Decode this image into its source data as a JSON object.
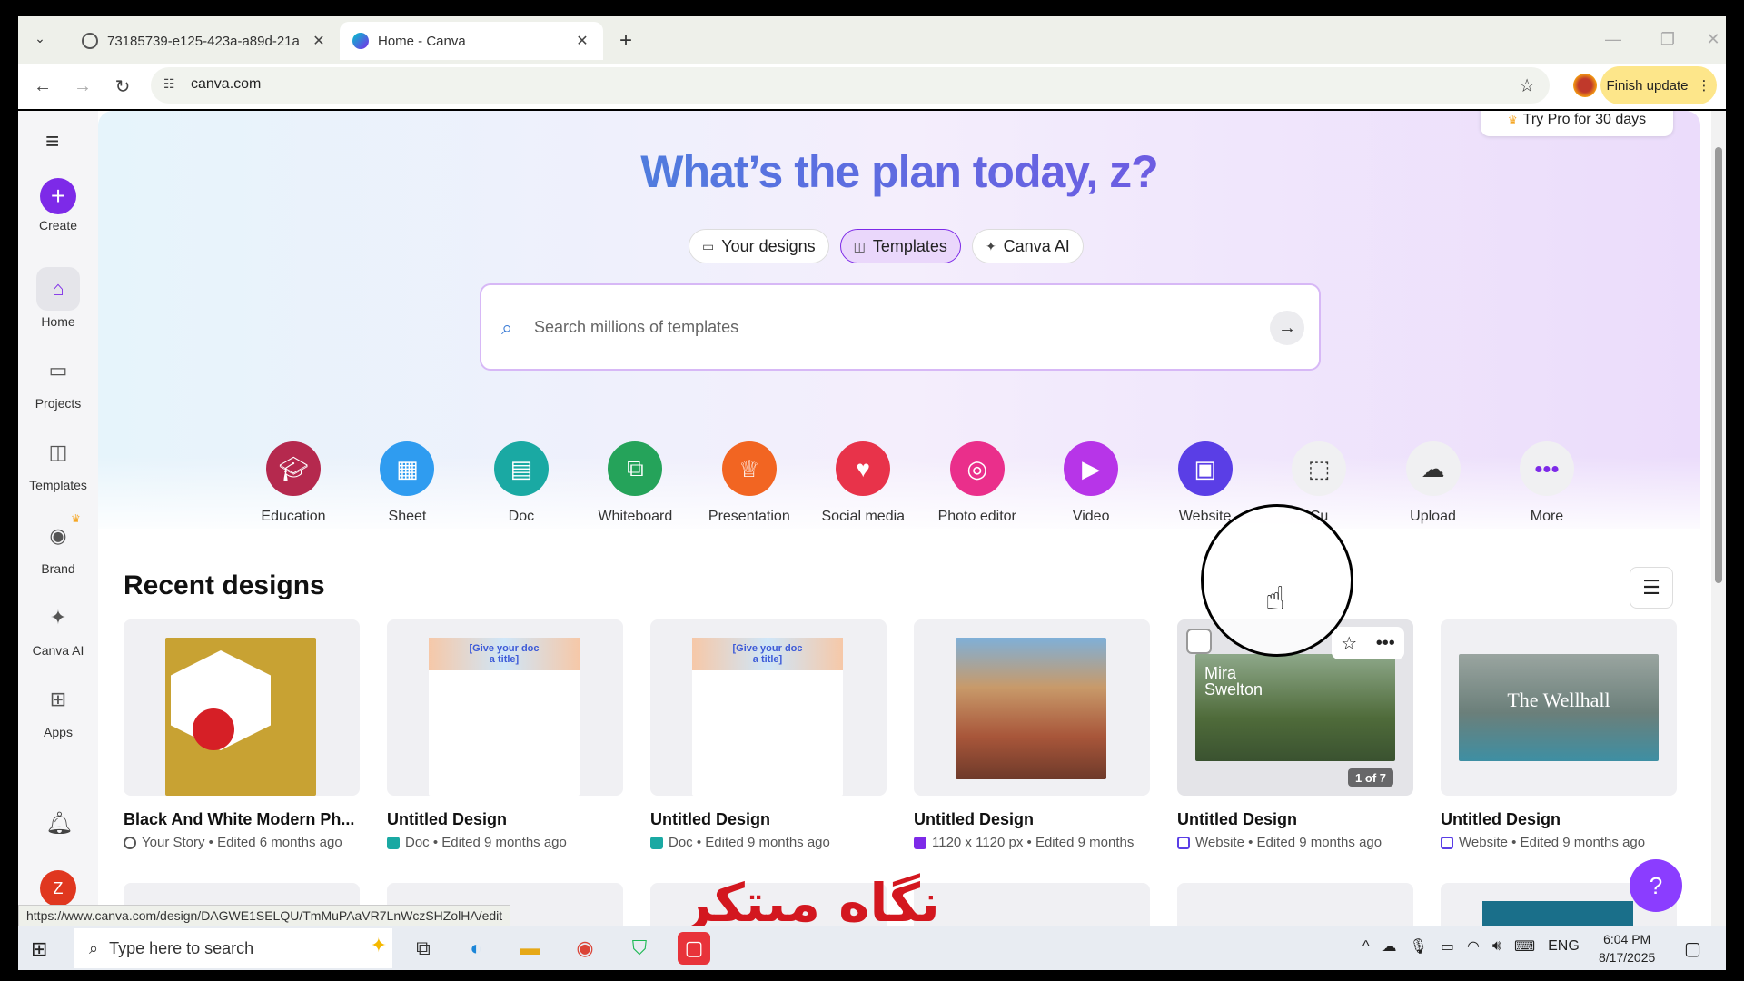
{
  "browser": {
    "tabs": [
      {
        "title": "73185739-e125-423a-a89d-21a",
        "active": false
      },
      {
        "title": "Home - Canva",
        "active": true
      }
    ],
    "new_tab": "+",
    "url": "canva.com",
    "finish_update": "Finish update"
  },
  "sidebar": {
    "items": [
      {
        "label": "Create",
        "icon": "plus-icon"
      },
      {
        "label": "Home",
        "icon": "home-icon"
      },
      {
        "label": "Projects",
        "icon": "folder-icon"
      },
      {
        "label": "Templates",
        "icon": "templates-icon"
      },
      {
        "label": "Brand",
        "icon": "brand-icon"
      },
      {
        "label": "Canva AI",
        "icon": "sparkle-icon"
      },
      {
        "label": "Apps",
        "icon": "apps-icon"
      }
    ],
    "avatar_letter": "Z"
  },
  "hero": {
    "pro_pill": "Try Pro for 30 days",
    "headline": "What’s the plan today, z?",
    "mode_tabs": [
      "Your designs",
      "Templates",
      "Canva AI"
    ],
    "active_mode": "Templates",
    "search_placeholder": "Search millions of templates"
  },
  "shortcuts": [
    {
      "label": "Education",
      "color": "#b5294e"
    },
    {
      "label": "Sheet",
      "color": "#2f9cf0"
    },
    {
      "label": "Doc",
      "color": "#1aa9a3"
    },
    {
      "label": "Whiteboard",
      "color": "#25a35a"
    },
    {
      "label": "Presentation",
      "color": "#f26522"
    },
    {
      "label": "Social media",
      "color": "#e8334a"
    },
    {
      "label": "Photo editor",
      "color": "#ea2f8b"
    },
    {
      "label": "Video",
      "color": "#b735e8"
    },
    {
      "label": "Website",
      "color": "#5a3ee6"
    },
    {
      "label": "Cu",
      "color": "#f0f0f2"
    },
    {
      "label": "Upload",
      "color": "#f0f0f2"
    },
    {
      "label": "More",
      "color": "#f0f0f2"
    }
  ],
  "recent": {
    "title": "Recent designs",
    "cards": [
      {
        "title": "Black And White Modern Ph...",
        "meta": "Your Story • Edited 6 months ago",
        "thumb_color": "#c8a233"
      },
      {
        "title": "Untitled Design",
        "meta": "Doc • Edited 9 months ago",
        "thumb_color": "#ffffff"
      },
      {
        "title": "Untitled Design",
        "meta": "Doc • Edited 9 months ago",
        "thumb_color": "#ffffff"
      },
      {
        "title": "Untitled Design",
        "meta": "1120 x 1120 px • Edited 9 months",
        "thumb_color": "#b55a3a"
      },
      {
        "title": "Untitled Design",
        "meta": "Website • Edited 9 months ago",
        "thumb_color": "#4f6b3a",
        "badge": "1 of 7",
        "thumb_text": "Mira Swelton"
      },
      {
        "title": "Untitled Design",
        "meta": "Website • Edited 9 months ago",
        "thumb_color": "#6b7f7a",
        "thumb_text": "The Wellhall"
      }
    ],
    "doc_thumb_text": "[Give your doc a title]"
  },
  "status_url": "https://www.canva.com/design/DAGWE1SELQU/TmMuPAaVR7LnWczSHZolHA/edit",
  "watermark": "نگاه مبتکر",
  "taskbar": {
    "search_placeholder": "Type here to search",
    "language": "ENG",
    "time": "6:04 PM",
    "date": "8/17/2025"
  }
}
